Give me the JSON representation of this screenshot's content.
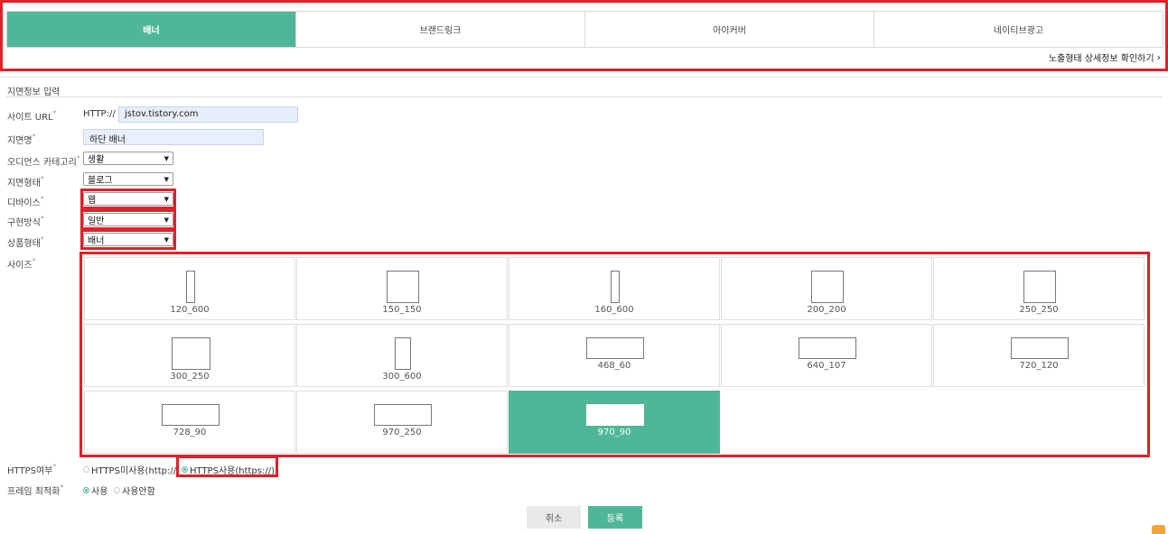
{
  "tabs": [
    {
      "label": "배너",
      "active": true
    },
    {
      "label": "브랜드링크",
      "active": false
    },
    {
      "label": "아이커버",
      "active": false
    },
    {
      "label": "네이티브광고",
      "active": false
    }
  ],
  "detail_link": "노출형태 상세정보 확인하기",
  "section_title": "지면정보 입력",
  "form": {
    "site_url": {
      "label": "사이트 URL",
      "prefix": "HTTP://",
      "value": "jstov.tistory.com"
    },
    "placement_name": {
      "label": "지면명",
      "value": "하단 배너"
    },
    "audience_category": {
      "label": "오디언스 카테고리",
      "value": "생활"
    },
    "placement_type": {
      "label": "지면형태",
      "value": "블로그"
    },
    "device": {
      "label": "디바이스",
      "value": "웹"
    },
    "implementation": {
      "label": "구현방식",
      "value": "일반"
    },
    "product_type": {
      "label": "상품형태",
      "value": "배너"
    },
    "size_label": "사이즈",
    "https": {
      "label": "HTTPS여부",
      "option_no": "HTTPS미사용(http://)",
      "option_yes": "HTTPS사용(https://)",
      "selected": "yes"
    },
    "frame": {
      "label": "프레임 최적화",
      "option_yes": "사용",
      "option_no": "사용안함",
      "selected": "yes"
    },
    "required_mark": "*"
  },
  "sizes": [
    {
      "label": "120_600",
      "w": 120,
      "h": 600
    },
    {
      "label": "150_150",
      "w": 150,
      "h": 150
    },
    {
      "label": "160_600",
      "w": 160,
      "h": 600
    },
    {
      "label": "200_200",
      "w": 200,
      "h": 200
    },
    {
      "label": "250_250",
      "w": 250,
      "h": 250
    },
    {
      "label": "300_250",
      "w": 300,
      "h": 250
    },
    {
      "label": "300_600",
      "w": 300,
      "h": 600
    },
    {
      "label": "468_60",
      "w": 468,
      "h": 60
    },
    {
      "label": "640_107",
      "w": 640,
      "h": 107
    },
    {
      "label": "720_120",
      "w": 720,
      "h": 120
    },
    {
      "label": "728_90",
      "w": 728,
      "h": 90
    },
    {
      "label": "970_250",
      "w": 970,
      "h": 250
    },
    {
      "label": "970_90",
      "w": 970,
      "h": 90,
      "selected": true
    }
  ],
  "buttons": {
    "cancel": "취소",
    "submit": "등록"
  },
  "colors": {
    "accent": "#4fb797",
    "highlight": "#e0202a"
  }
}
